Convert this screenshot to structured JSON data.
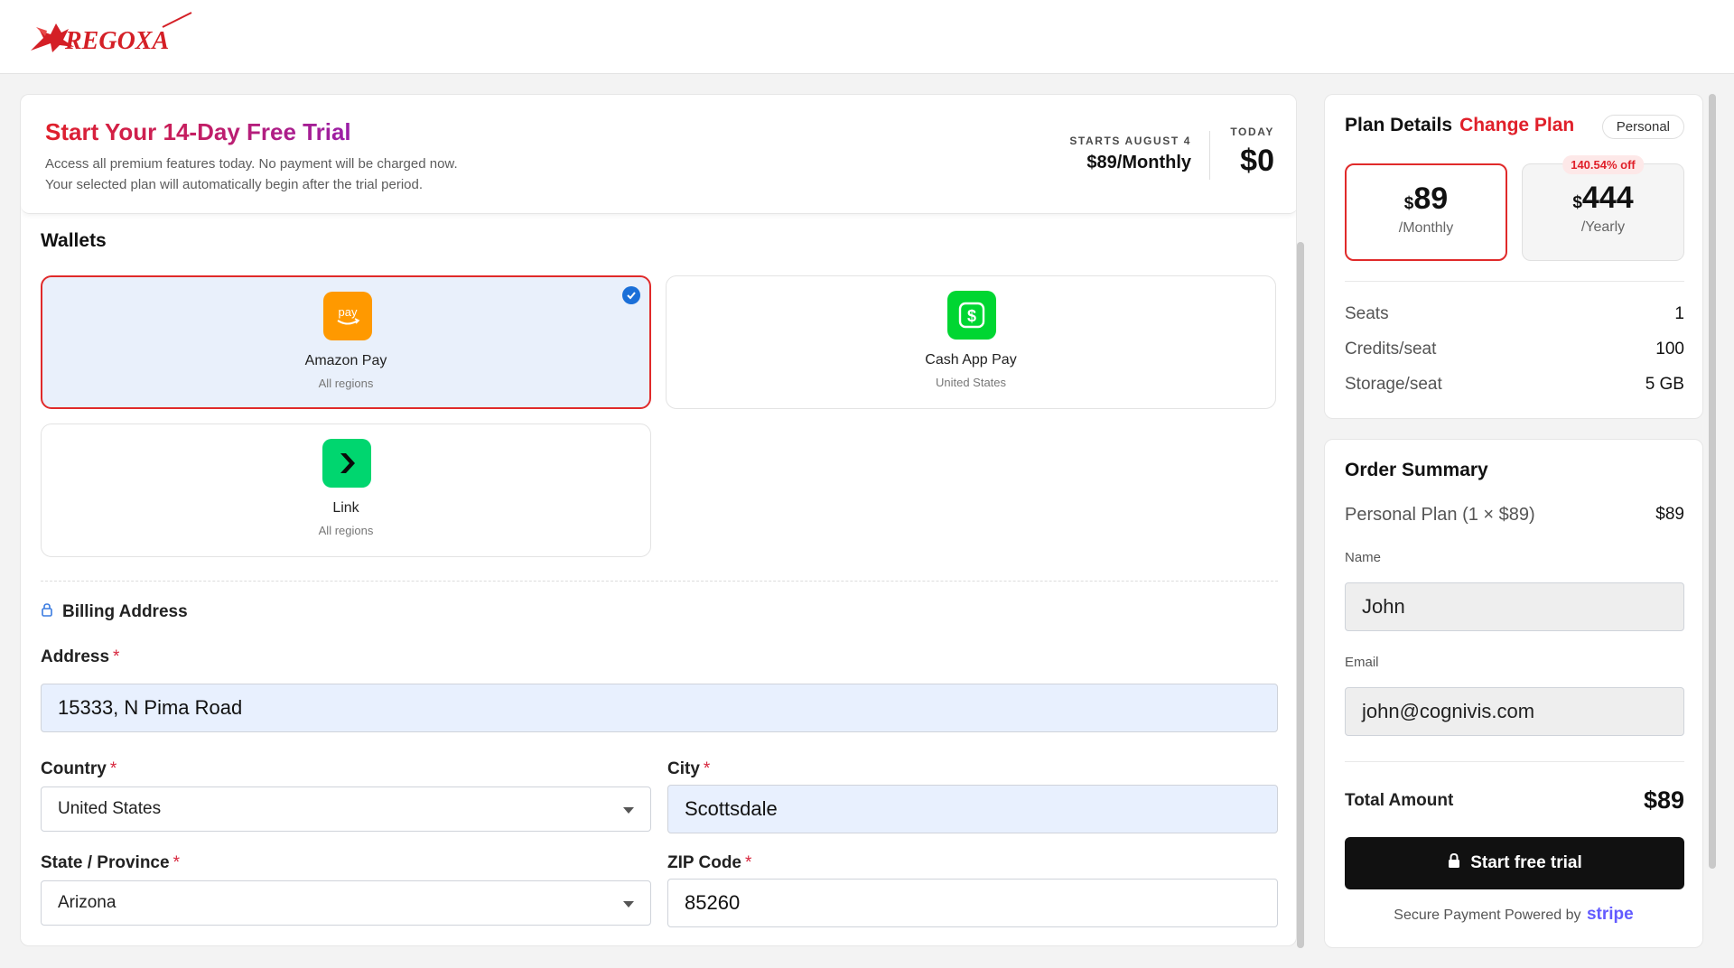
{
  "brand": {
    "logo_text": "REGOXA"
  },
  "trial": {
    "title": "Start Your 14-Day Free Trial",
    "line1": "Access all premium features today. No payment will be charged now.",
    "line2": "Your selected plan will automatically begin after the trial period.",
    "starts_label": "STARTS AUGUST 4",
    "starts_value": "$89/Monthly",
    "today_label": "TODAY",
    "today_value": "$0"
  },
  "wallets": {
    "title": "Wallets",
    "items": [
      {
        "name": "Amazon Pay",
        "region": "All regions",
        "icon": "amazon-pay-icon",
        "icon_text": "pay",
        "color": "#ff9900",
        "selected": true
      },
      {
        "name": "Cash App Pay",
        "region": "United States",
        "icon": "cash-app-icon",
        "icon_text": "$",
        "color": "#00d632",
        "selected": false
      },
      {
        "name": "Link",
        "region": "All regions",
        "icon": "link-icon",
        "icon_text": "›",
        "color": "#00d66f",
        "selected": false
      }
    ]
  },
  "billing": {
    "title": "Billing Address",
    "address_label": "Address",
    "address_value": "15333, N Pima Road",
    "country_label": "Country",
    "country_value": "United States",
    "city_label": "City",
    "city_value": "Scottsdale",
    "state_label": "State / Province",
    "state_value": "Arizona",
    "zip_label": "ZIP Code",
    "zip_value": "85260",
    "required_mark": "*"
  },
  "plan": {
    "title": "Plan Details",
    "change_label": "Change Plan",
    "badge": "Personal",
    "monthly": {
      "currency": "$",
      "amount": "89",
      "period": "/Monthly"
    },
    "yearly": {
      "currency": "$",
      "amount": "444",
      "period": "/Yearly",
      "discount": "140.54% off"
    },
    "details": [
      {
        "key": "Seats",
        "value": "1"
      },
      {
        "key": "Credits/seat",
        "value": "100"
      },
      {
        "key": "Storage/seat",
        "value": "5 GB"
      }
    ]
  },
  "order": {
    "title": "Order Summary",
    "line_label": "Personal Plan",
    "line_qty": "(1 × $89)",
    "line_value": "$89",
    "name_label": "Name",
    "name_value": "John",
    "email_label": "Email",
    "email_value": "john@cognivis.com",
    "total_label": "Total Amount",
    "total_value": "$89",
    "cta_label": "Start free trial",
    "powered_text": "Secure Payment Powered by",
    "powered_brand": "stripe"
  },
  "colors": {
    "accent": "#e02a2a",
    "cta": "#111111",
    "selected_bg": "#e9f0fb",
    "stripe": "#635bff"
  }
}
